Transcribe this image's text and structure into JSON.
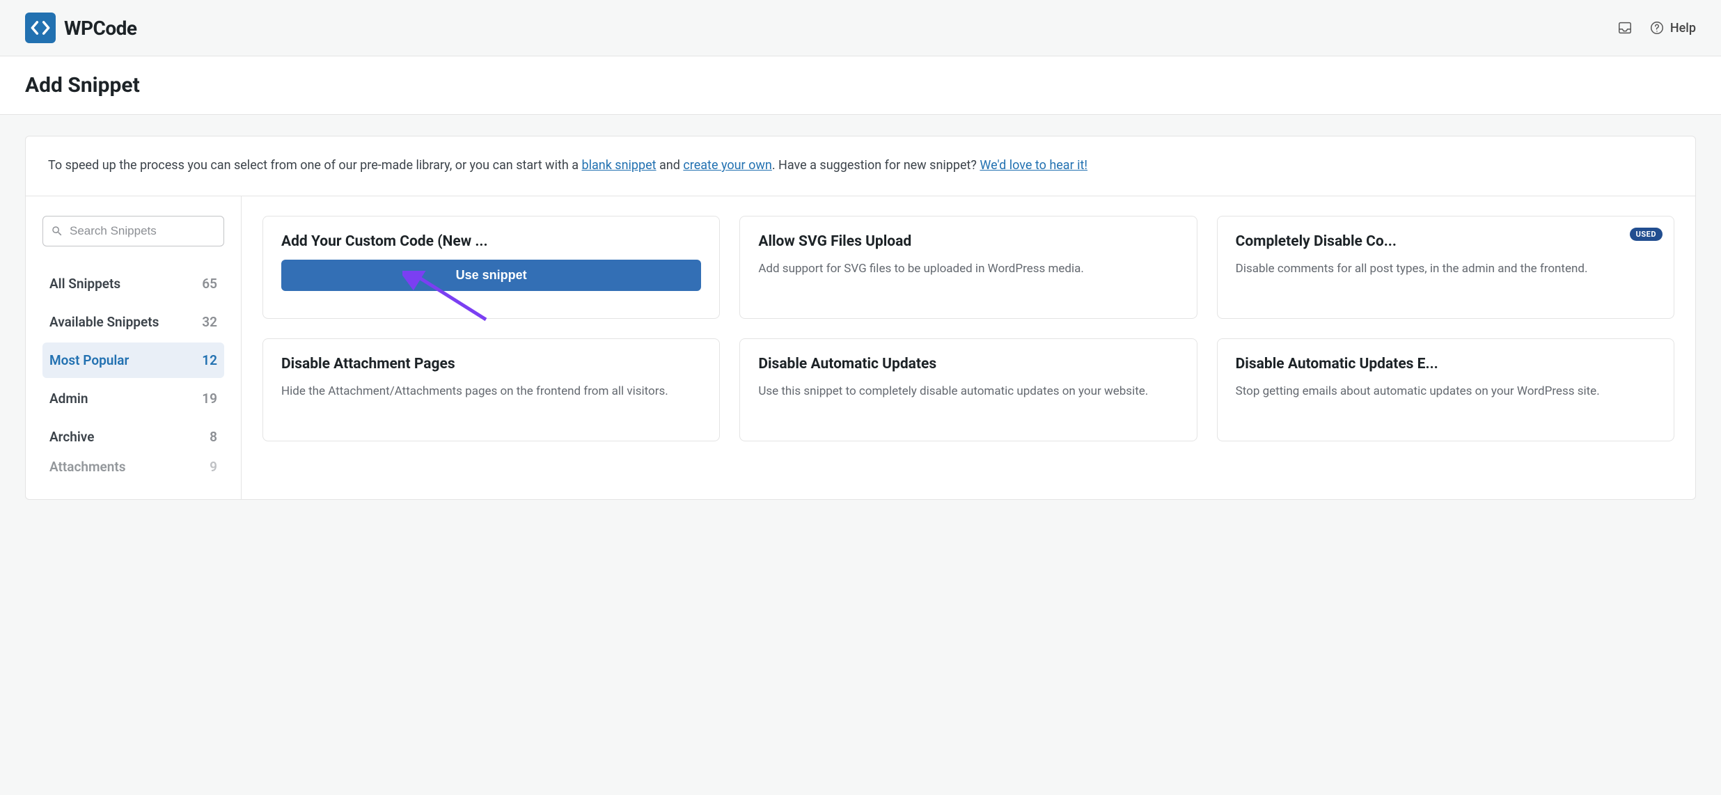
{
  "header": {
    "brand": "WPCode",
    "help_label": "Help"
  },
  "page": {
    "title": "Add Snippet"
  },
  "intro": {
    "text_before_link1": "To speed up the process you can select from one of our pre-made library, or you can start with a ",
    "link1": "blank snippet",
    "text_between": " and ",
    "link2": "create your own",
    "text_after_link2": ". Have a suggestion for new snippet? ",
    "link3": "We'd love to hear it!"
  },
  "search": {
    "placeholder": "Search Snippets"
  },
  "categories": [
    {
      "label": "All Snippets",
      "count": "65",
      "active": false
    },
    {
      "label": "Available Snippets",
      "count": "32",
      "active": false
    },
    {
      "label": "Most Popular",
      "count": "12",
      "active": true
    },
    {
      "label": "Admin",
      "count": "19",
      "active": false
    },
    {
      "label": "Archive",
      "count": "8",
      "active": false
    },
    {
      "label": "Attachments",
      "count": "9",
      "active": false
    }
  ],
  "cards": [
    {
      "title": "Add Your Custom Code (New ...",
      "description": "",
      "button_label": "Use snippet",
      "used_badge": ""
    },
    {
      "title": "Allow SVG Files Upload",
      "description": "Add support for SVG files to be uploaded in WordPress media.",
      "button_label": "",
      "used_badge": ""
    },
    {
      "title": "Completely Disable Co...",
      "description": "Disable comments for all post types, in the admin and the frontend.",
      "button_label": "",
      "used_badge": "USED"
    },
    {
      "title": "Disable Attachment Pages",
      "description": "Hide the Attachment/Attachments pages on the frontend from all visitors.",
      "button_label": "",
      "used_badge": ""
    },
    {
      "title": "Disable Automatic Updates",
      "description": "Use this snippet to completely disable automatic updates on your website.",
      "button_label": "",
      "used_badge": ""
    },
    {
      "title": "Disable Automatic Updates E...",
      "description": "Stop getting emails about automatic updates on your WordPress site.",
      "button_label": "",
      "used_badge": ""
    }
  ]
}
